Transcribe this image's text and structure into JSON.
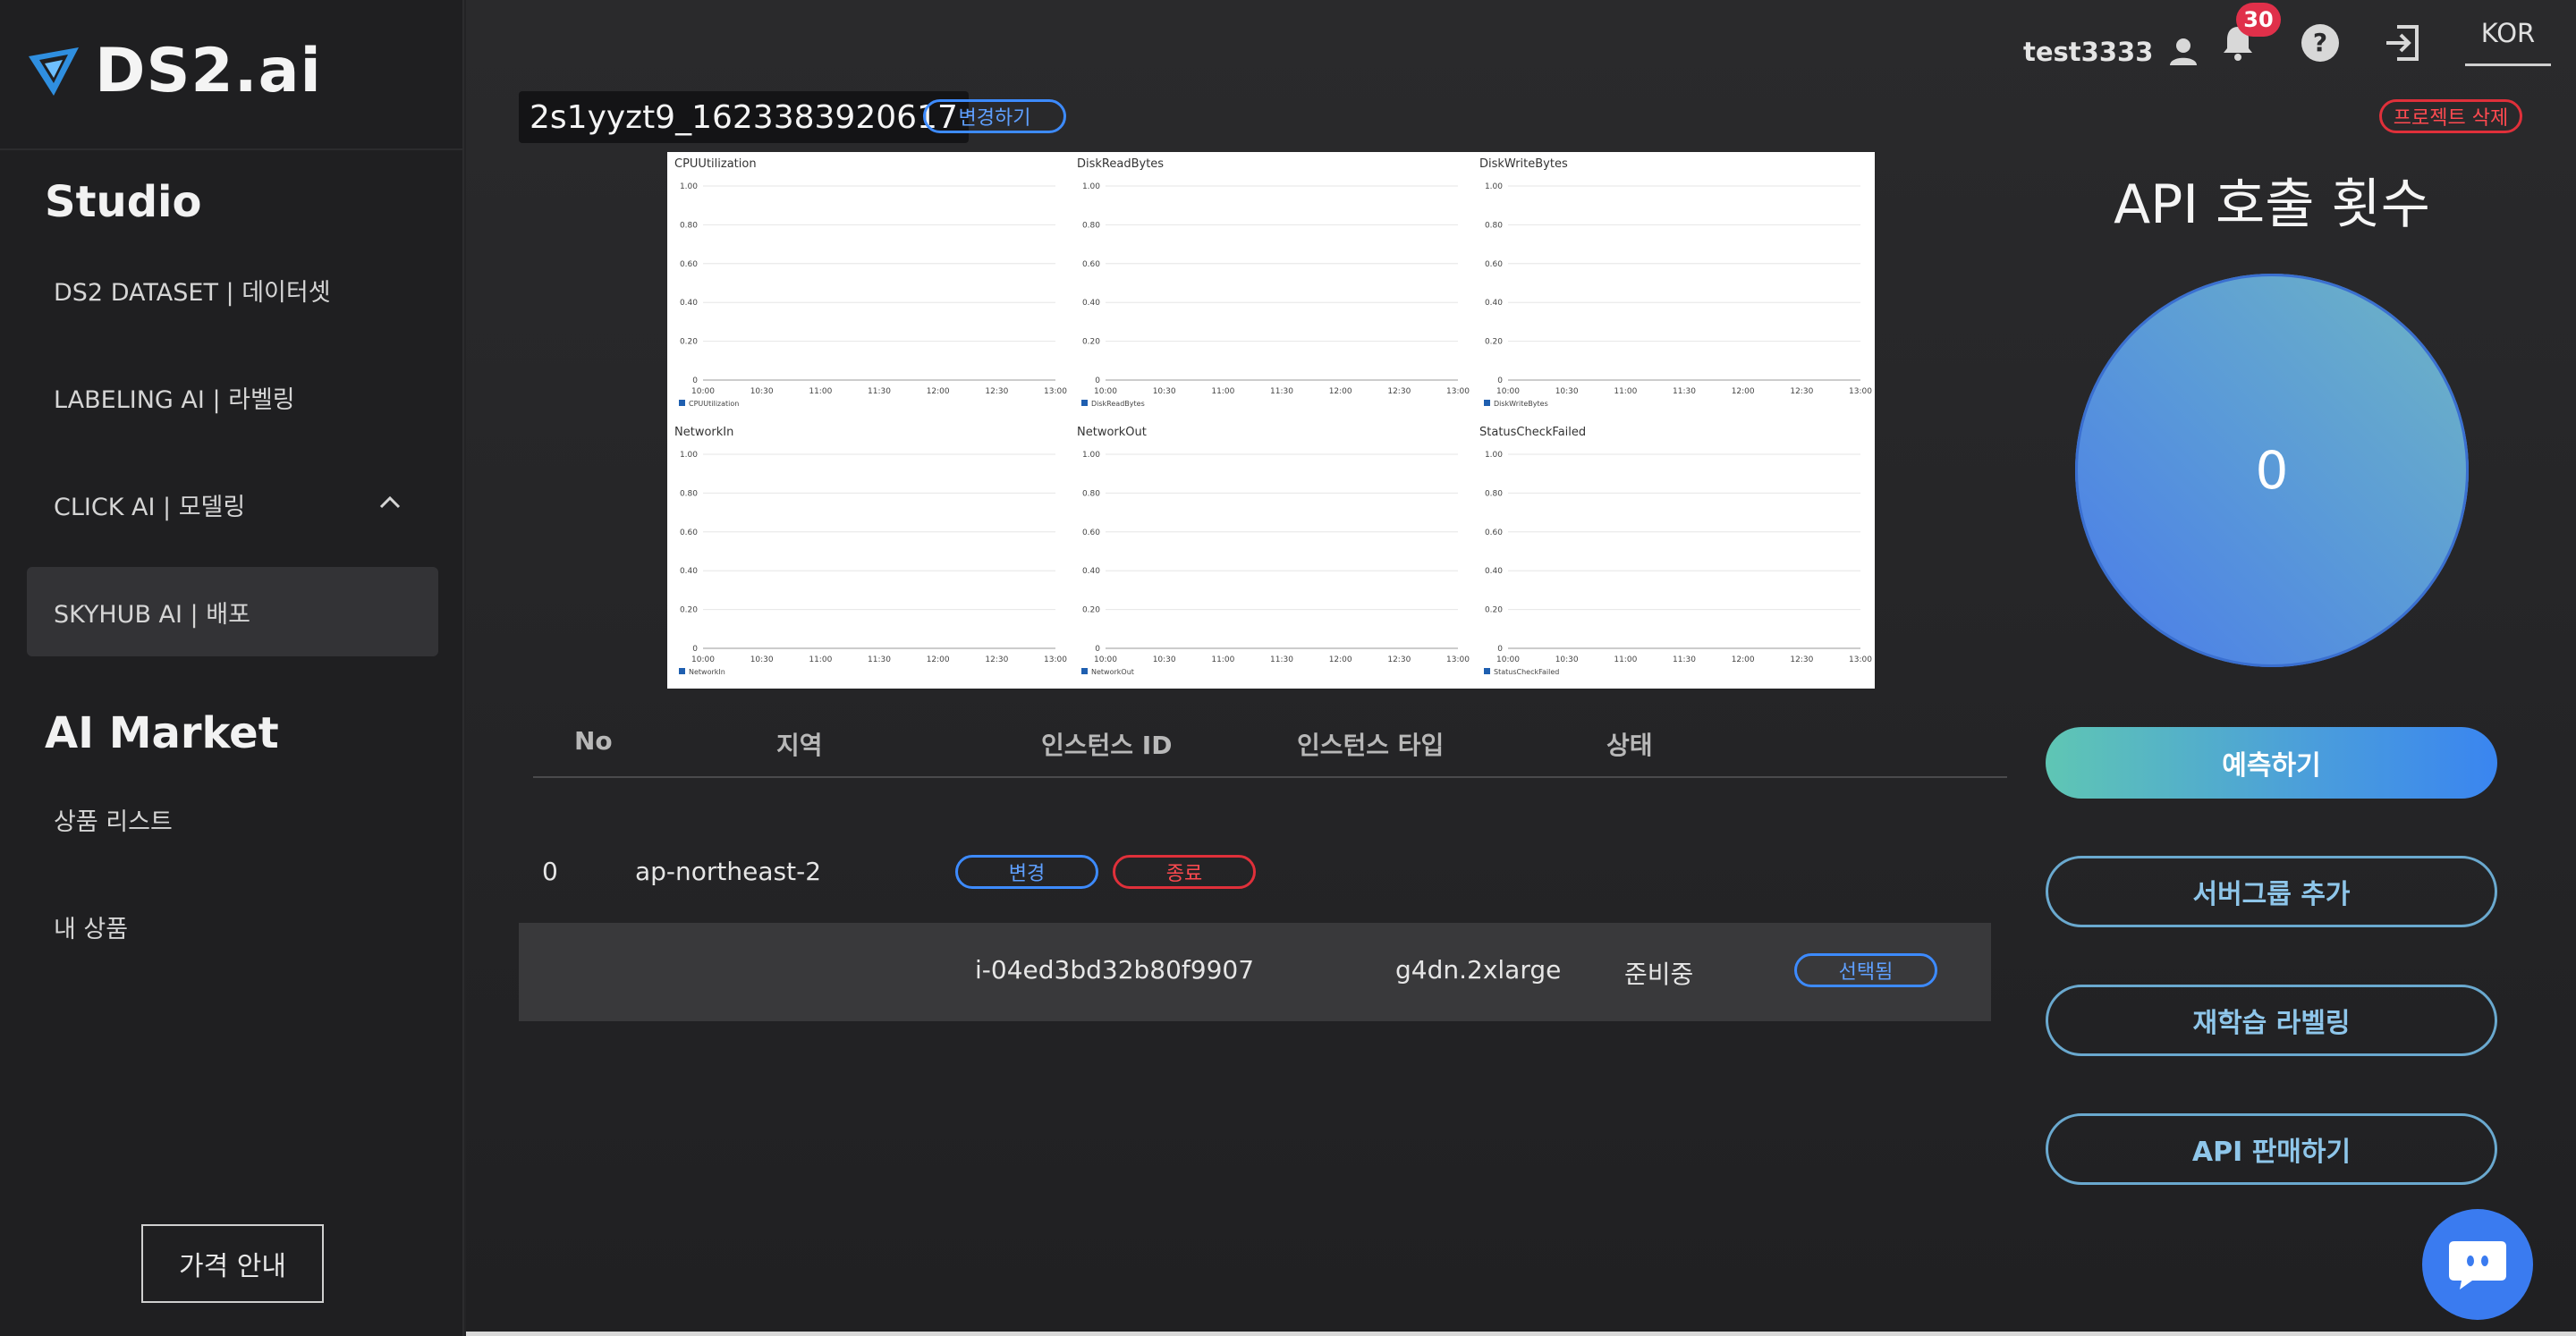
{
  "brand": {
    "name": "DS2.ai"
  },
  "sidebar": {
    "sections": [
      {
        "title": "Studio"
      },
      {
        "title": "AI Market"
      }
    ],
    "studio_items": [
      {
        "label": "DS2 DATASET | 데이터셋"
      },
      {
        "label": "LABELING AI | 라벨링"
      },
      {
        "label": "CLICK AI | 모델링"
      },
      {
        "label": "SKYHUB AI | 배포"
      }
    ],
    "market_items": [
      {
        "label": "상품 리스트"
      },
      {
        "label": "내 상품"
      }
    ],
    "price_button": "가격 안내"
  },
  "topbar": {
    "username": "test3333",
    "notification_count": "30",
    "language": "KOR"
  },
  "project": {
    "id": "2s1yyzt9_1623383920617",
    "change_label": "변경하기",
    "delete_label": "프로젝트 삭제"
  },
  "charts": {
    "x_ticks": [
      "10:00",
      "10:30",
      "11:00",
      "11:30",
      "12:00",
      "12:30",
      "13:00"
    ],
    "y_ticks": [
      "0",
      "0.20",
      "0.40",
      "0.60",
      "0.80",
      "1.00"
    ]
  },
  "chart_data": [
    {
      "type": "line",
      "title": "CPUUtilization",
      "series": [
        {
          "name": "CPUUtilization",
          "values": []
        }
      ],
      "ylim": [
        0,
        1
      ],
      "x": [
        "10:00",
        "10:30",
        "11:00",
        "11:30",
        "12:00",
        "12:30",
        "13:00"
      ]
    },
    {
      "type": "line",
      "title": "DiskReadBytes",
      "series": [
        {
          "name": "DiskReadBytes",
          "values": []
        }
      ],
      "ylim": [
        0,
        1
      ],
      "x": [
        "10:00",
        "10:30",
        "11:00",
        "11:30",
        "12:00",
        "12:30",
        "13:00"
      ]
    },
    {
      "type": "line",
      "title": "DiskWriteBytes",
      "series": [
        {
          "name": "DiskWriteBytes",
          "values": []
        }
      ],
      "ylim": [
        0,
        1
      ],
      "x": [
        "10:00",
        "10:30",
        "11:00",
        "11:30",
        "12:00",
        "12:30",
        "13:00"
      ]
    },
    {
      "type": "line",
      "title": "NetworkIn",
      "series": [
        {
          "name": "NetworkIn",
          "values": []
        }
      ],
      "ylim": [
        0,
        1
      ],
      "x": [
        "10:00",
        "10:30",
        "11:00",
        "11:30",
        "12:00",
        "12:30",
        "13:00"
      ]
    },
    {
      "type": "line",
      "title": "NetworkOut",
      "series": [
        {
          "name": "NetworkOut",
          "values": []
        }
      ],
      "ylim": [
        0,
        1
      ],
      "x": [
        "10:00",
        "10:30",
        "11:00",
        "11:30",
        "12:00",
        "12:30",
        "13:00"
      ]
    },
    {
      "type": "line",
      "title": "StatusCheckFailed",
      "series": [
        {
          "name": "StatusCheckFailed",
          "values": []
        }
      ],
      "ylim": [
        0,
        1
      ],
      "x": [
        "10:00",
        "10:30",
        "11:00",
        "11:30",
        "12:00",
        "12:30",
        "13:00"
      ]
    }
  ],
  "table": {
    "headers": [
      "No",
      "지역",
      "인스턴스 ID",
      "인스턴스 타입",
      "상태"
    ],
    "group": {
      "no": "0",
      "region": "ap-northeast-2",
      "change_label": "변경",
      "terminate_label": "종료"
    },
    "instance": {
      "id": "i-04ed3bd32b80f9907",
      "type": "g4dn.2xlarge",
      "status": "준비중",
      "select_label": "선택됨"
    }
  },
  "api_panel": {
    "title": "API 호출 횟수",
    "count": "0"
  },
  "actions": {
    "predict": "예측하기",
    "add_server_group": "서버그룹 추가",
    "relabel": "재학습 라벨링",
    "sell_api": "API 판매하기"
  },
  "colors": {
    "accent_blue": "#3d8bff",
    "danger_red": "#e0303a",
    "badge_red": "#e0304a"
  }
}
